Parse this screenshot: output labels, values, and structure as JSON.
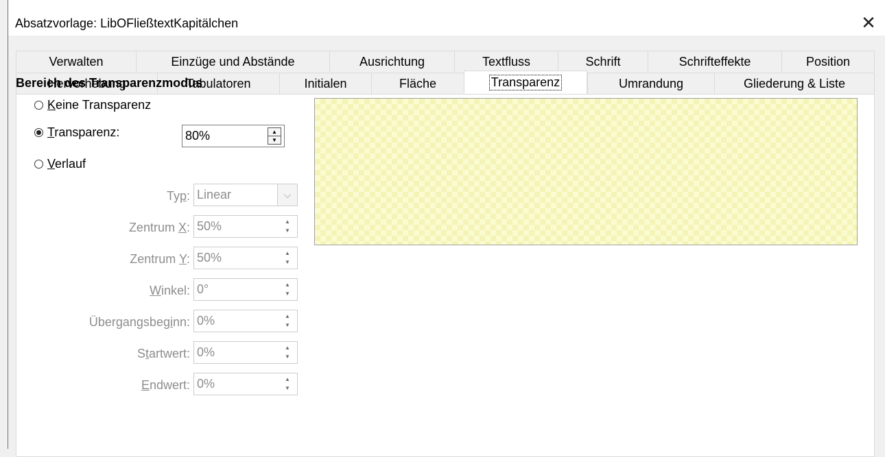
{
  "window": {
    "title": "Absatzvorlage: LibOFließtextKapitälchen"
  },
  "tabs": {
    "row1": [
      "Verwalten",
      "Einzüge und Abstände",
      "Ausrichtung",
      "Textfluss",
      "Schrift",
      "Schrifteffekte",
      "Position"
    ],
    "row2": [
      "Hervorhebung",
      "Tabulatoren",
      "Initialen",
      "Fläche",
      "Transparenz",
      "Umrandung",
      "Gliederung & Liste"
    ],
    "active": "Transparenz"
  },
  "section": {
    "title": "Bereich des Transparenzmodus"
  },
  "modes": {
    "none": {
      "mnemonic": "K",
      "rest": "eine Transparenz",
      "checked": false
    },
    "transparency": {
      "mnemonic": "T",
      "rest": "ransparenz:",
      "checked": true,
      "value": "80%"
    },
    "gradient": {
      "mnemonic": "V",
      "rest": "erlauf",
      "checked": false
    }
  },
  "gradient_fields": {
    "type": {
      "label_pre": "Ty",
      "label_mn": "p",
      "label_post": ":",
      "value": "Linear"
    },
    "center_x": {
      "label_pre": "Zentrum ",
      "label_mn": "X",
      "label_post": ":",
      "value": "50%"
    },
    "center_y": {
      "label_pre": "Zentrum ",
      "label_mn": "Y",
      "label_post": ":",
      "value": "50%"
    },
    "angle": {
      "label_pre": "",
      "label_mn": "W",
      "label_post": "inkel:",
      "value": "0°"
    },
    "border": {
      "label_pre": "Übergangsbeg",
      "label_mn": "i",
      "label_post": "nn:",
      "value": "0%"
    },
    "start": {
      "label_pre": "S",
      "label_mn": "t",
      "label_post": "artwert:",
      "value": "0%"
    },
    "end": {
      "label_pre": "",
      "label_mn": "E",
      "label_post": "ndwert:",
      "value": "0%"
    }
  },
  "colors": {
    "preview_fill": "#fbfbd0",
    "preview_check": "#f4f4b8"
  },
  "icons": {
    "close": "close-icon",
    "spin_up": "caret-up-icon",
    "spin_down": "caret-down-icon",
    "dropdown": "chevron-down-icon"
  }
}
